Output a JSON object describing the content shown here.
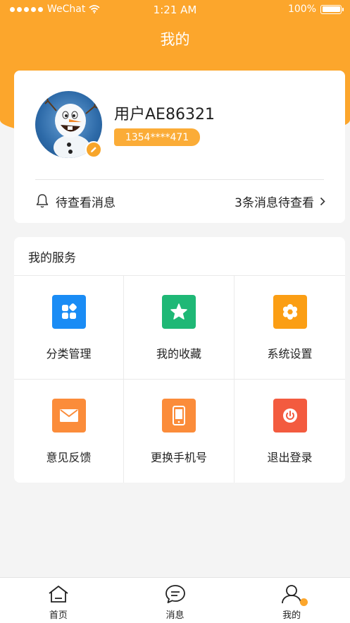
{
  "status_bar": {
    "carrier": "WeChat",
    "time": "1:21 AM",
    "battery": "100%"
  },
  "header": {
    "title": "我的"
  },
  "profile": {
    "username": "用户AE86321",
    "phone": "1354****471"
  },
  "messages": {
    "label": "待查看消息",
    "count_text": "3条消息待查看"
  },
  "services": {
    "title": "我的服务",
    "items": [
      {
        "label": "分类管理",
        "icon": "category-icon",
        "color": "#1a8cf5"
      },
      {
        "label": "我的收藏",
        "icon": "star-icon",
        "color": "#1fb876"
      },
      {
        "label": "系统设置",
        "icon": "gear-icon",
        "color": "#fb9e14"
      },
      {
        "label": "意见反馈",
        "icon": "mail-icon",
        "color": "#fb8c3a"
      },
      {
        "label": "更换手机号",
        "icon": "phone-icon",
        "color": "#fb8c3a"
      },
      {
        "label": "退出登录",
        "icon": "power-icon",
        "color": "#f35b3f"
      }
    ]
  },
  "tabbar": {
    "items": [
      {
        "label": "首页",
        "icon": "home-icon"
      },
      {
        "label": "消息",
        "icon": "message-icon"
      },
      {
        "label": "我的",
        "icon": "user-icon",
        "active": true
      }
    ]
  },
  "colors": {
    "accent": "#fca62c"
  }
}
